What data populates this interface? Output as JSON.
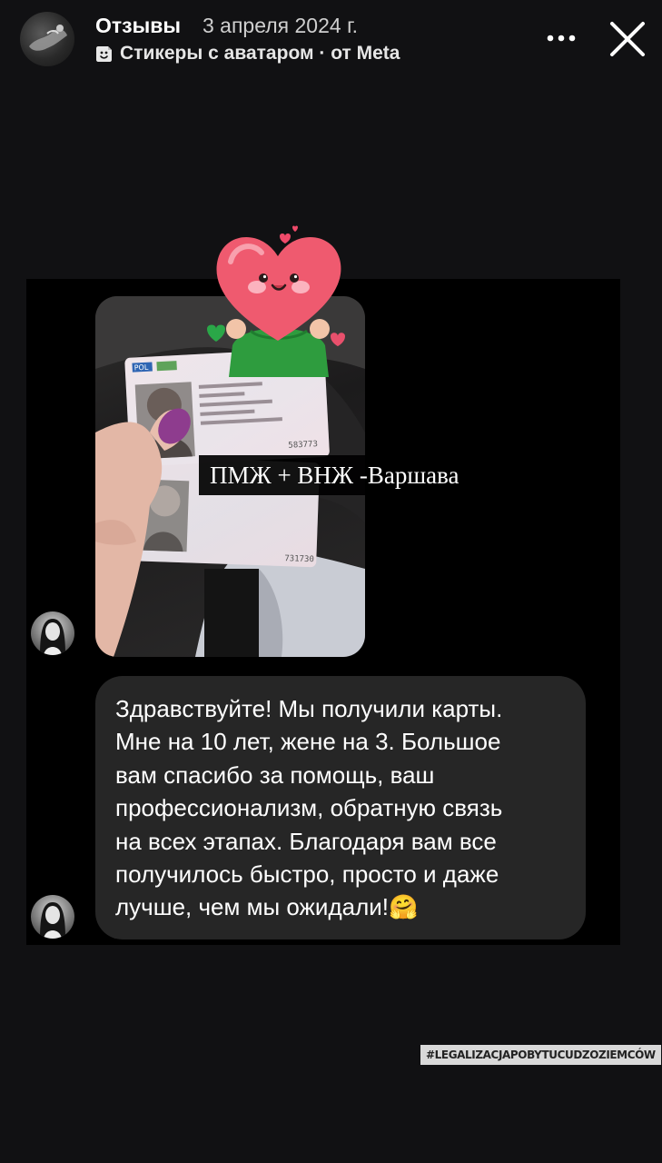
{
  "header": {
    "title": "Отзывы",
    "date": "3 апреля 2024 г.",
    "subtitle": "Стикеры с аватаром · от Meta",
    "more_icon": "more-icon",
    "close_icon": "close-icon"
  },
  "story": {
    "photo_message": {
      "caption_overlay": "ПМЖ + ВНЖ -Варшава",
      "card_numbers": [
        "583773",
        "731730"
      ],
      "card_country": "POL"
    },
    "text_message": {
      "text": "Здравствуйте! Мы получили карты.\nМне на 10 лет, жене на 3. Большое\nвам спасибо за помощь, ваш\nпрофессионализм, обратную связь\nна всех этапах. Благодаря вам все\nполучилось быстро, просто и даже\nлучше, чем мы ожидали!",
      "emoji": "🤗"
    },
    "hashtag": "#LEGALIZACJAPOBYTUCUDZOZIEMCÓW"
  },
  "colors": {
    "background": "#111113",
    "bubble": "#262626",
    "card": "#000000",
    "heart": "#ef5a6f",
    "accent_green": "#2e9c3e"
  }
}
